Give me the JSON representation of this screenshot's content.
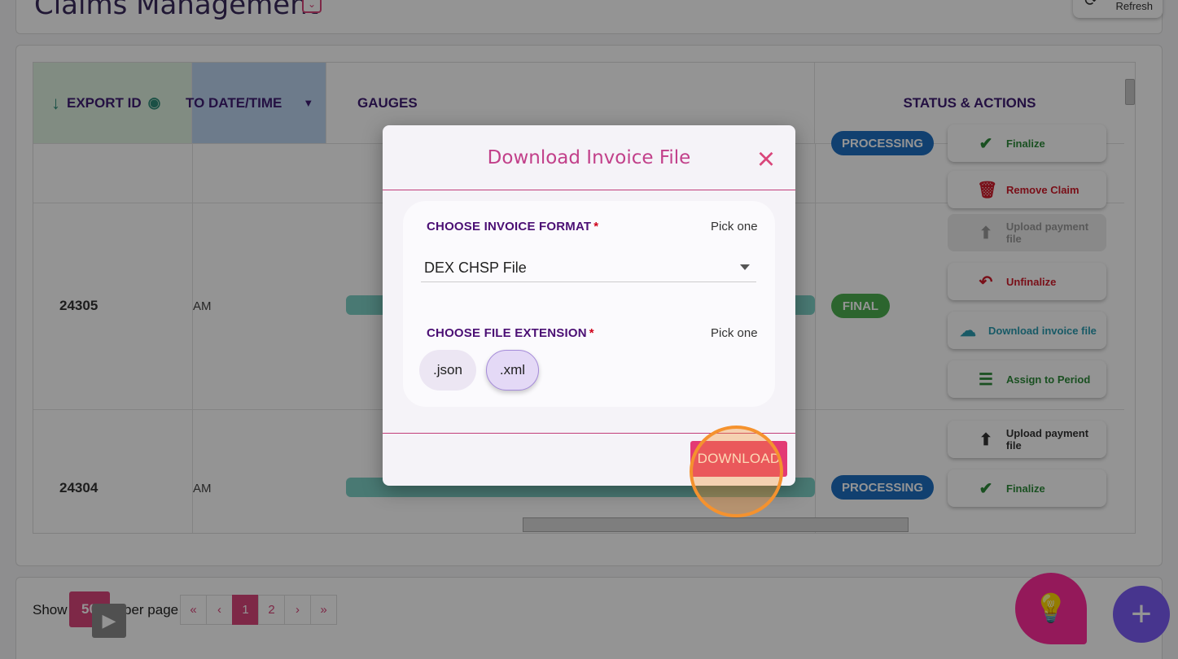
{
  "header": {
    "title": "Claims Management",
    "toggle_icon": "chevron-down-icon",
    "refresh_label": "Refresh"
  },
  "table": {
    "columns": {
      "export_id": "EXPORT ID",
      "date_time": "TO DATE/TIME",
      "gauges": "GAUGES",
      "status_actions": "STATUS & ACTIONS"
    },
    "rows": [
      {
        "status": "PROCESSING",
        "actions": [
          "Finalize",
          "Remove Claim"
        ]
      },
      {
        "export_id": "24305",
        "time": "AM",
        "status": "FINAL",
        "actions": [
          "Upload payment file",
          "Unfinalize",
          "Download invoice file",
          "Assign to Period"
        ]
      },
      {
        "export_id": "24304",
        "time": "AM",
        "status": "PROCESSING",
        "actions": [
          "Upload payment file",
          "Finalize"
        ]
      }
    ]
  },
  "footer": {
    "show_label": "Show",
    "per_page_value": "50",
    "per_page_label": "per page",
    "pagination": [
      "«",
      "‹",
      "1",
      "2",
      "›",
      "»"
    ],
    "active_page": "1"
  },
  "modal": {
    "title": "Download Invoice File",
    "format_label": "CHOOSE INVOICE FORMAT",
    "format_hint": "Pick one",
    "format_value": "DEX CHSP File",
    "extension_label": "CHOOSE FILE EXTENSION",
    "extension_hint": "Pick one",
    "extensions": [
      ".json",
      ".xml"
    ],
    "selected_extension": ".xml",
    "download_label": "DOWNLOAD"
  },
  "colors": {
    "accent": "#d9457a",
    "purple": "#4b0f74",
    "final": "#4caf50",
    "processing": "#1e6fc2",
    "download": "#e33a74"
  }
}
